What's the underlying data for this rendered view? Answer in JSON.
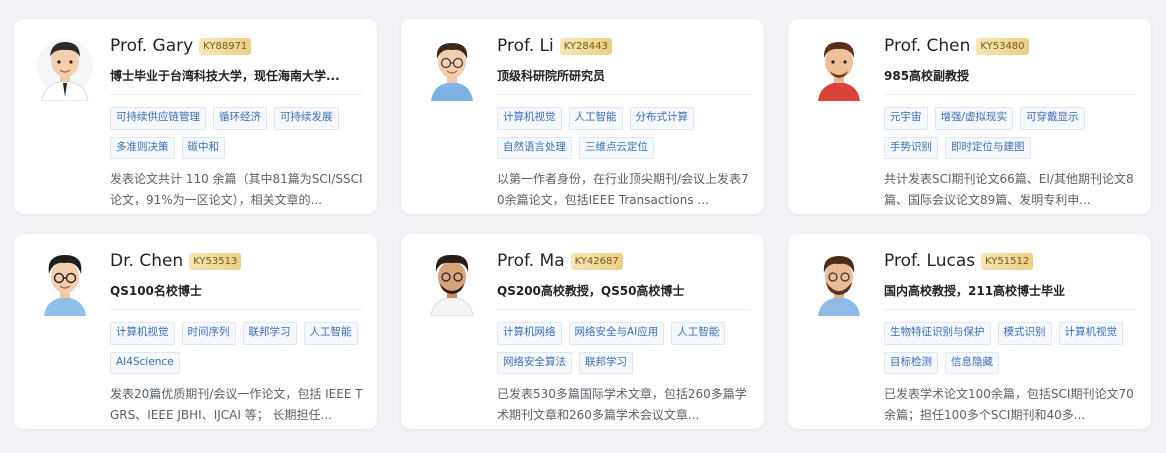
{
  "colors": {
    "background": "#f1f3f6",
    "card": "#ffffff",
    "badge_gradient": [
      "#f6e6b7",
      "#e9cf86"
    ],
    "tag_text": "#3a6fb7"
  },
  "cards": [
    {
      "name": "Prof. Gary",
      "code": "KY88971",
      "title": "博士毕业于台湾科技大学，现任海南大学...",
      "tags": [
        "可持续供应链管理",
        "循环经济",
        "可持续发展",
        "多准则决策",
        "碳中和"
      ],
      "desc": "发表论文共计 110 余篇（其中81篇为SCI/SSCI论文，91%为一区论文），相关文章的...",
      "avatar": "avatar-suit-icon"
    },
    {
      "name": "Prof. Li",
      "code": "KY28443",
      "title": "顶级科研院所研究员",
      "tags": [
        "计算机视觉",
        "人工智能",
        "分布式计算",
        "自然语言处理",
        "三维点云定位"
      ],
      "desc": "以第一作者身份，在行业顶尖期刊/会议上发表70余篇论文，包括IEEE Transactions ...",
      "avatar": "avatar-glasses-icon"
    },
    {
      "name": "Prof. Chen",
      "code": "KY53480",
      "title": "985高校副教授",
      "tags": [
        "元宇宙",
        "增强/虚拟现实",
        "可穿戴显示",
        "手势识别",
        "即时定位与建图"
      ],
      "desc": "共计发表SCI期刊论文66篇、EI/其他期刊论文8篇、国际会议论文89篇、发明专利申...",
      "avatar": "avatar-red-shirt-icon"
    },
    {
      "name": "Dr. Chen",
      "code": "KY53513",
      "title": "QS100名校博士",
      "tags": [
        "计算机视觉",
        "时间序列",
        "联邦学习",
        "人工智能",
        "AI4Science"
      ],
      "desc": "发表20篇优质期刊/会议一作论文，包括 IEEE TGRS、IEEE JBHI、IJCAI 等； 长期担任...",
      "avatar": "avatar-glasses-icon"
    },
    {
      "name": "Prof. Ma",
      "code": "KY42687",
      "title": "QS200高校教授，QS50高校博士",
      "tags": [
        "计算机网络",
        "网络安全与AI应用",
        "人工智能",
        "网络安全算法",
        "联邦学习"
      ],
      "desc": "已发表530多篇国际学术文章，包括260多篇学术期刊文章和260多篇学术会议文章...",
      "avatar": "avatar-curly-icon"
    },
    {
      "name": "Prof. Lucas",
      "code": "KY51512",
      "title": "国内高校教授，211高校博士毕业",
      "tags": [
        "生物特征识别与保护",
        "模式识别",
        "计算机视觉",
        "目标检测",
        "信息隐藏"
      ],
      "desc": "已发表学术论文100余篇，包括SCI期刊论文70余篇；担任100多个SCI期刊和40多...",
      "avatar": "avatar-beard-icon"
    }
  ]
}
